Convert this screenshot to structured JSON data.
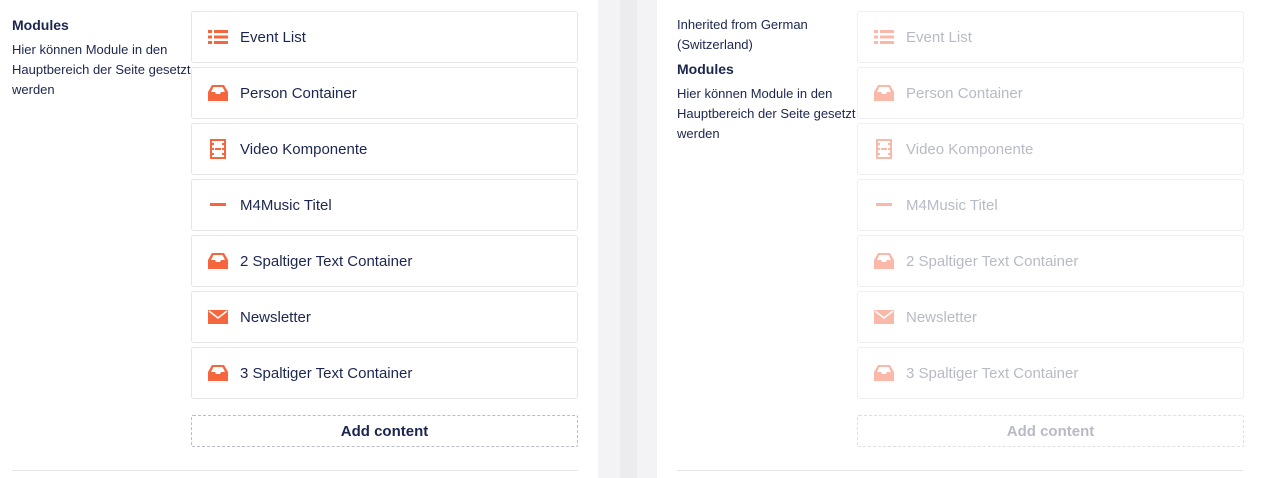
{
  "colors": {
    "accent": "#f5663f",
    "text": "#1b264f",
    "muted": "#b8bac6",
    "border": "#e6e6ea",
    "background": "#f3f3f5"
  },
  "left": {
    "property_title": "Modules",
    "property_description": "Hier können Module in den Hauptbereich der Seite gesetzt werden",
    "blocks": [
      {
        "label": "Event List",
        "icon": "list-icon"
      },
      {
        "label": "Person Container",
        "icon": "inbox-icon"
      },
      {
        "label": "Video Komponente",
        "icon": "film-icon"
      },
      {
        "label": "M4Music Titel",
        "icon": "minus-icon"
      },
      {
        "label": "2 Spaltiger Text Container",
        "icon": "inbox-icon"
      },
      {
        "label": "Newsletter",
        "icon": "envelope-icon"
      },
      {
        "label": "3 Spaltiger Text Container",
        "icon": "inbox-icon"
      }
    ],
    "add_content_label": "Add content"
  },
  "right": {
    "inherited_text": "Inherited from German (Switzerland)",
    "property_title": "Modules",
    "property_description": "Hier können Module in den Hauptbereich der Seite gesetzt werden",
    "blocks": [
      {
        "label": "Event List",
        "icon": "list-icon"
      },
      {
        "label": "Person Container",
        "icon": "inbox-icon"
      },
      {
        "label": "Video Komponente",
        "icon": "film-icon"
      },
      {
        "label": "M4Music Titel",
        "icon": "minus-icon"
      },
      {
        "label": "2 Spaltiger Text Container",
        "icon": "inbox-icon"
      },
      {
        "label": "Newsletter",
        "icon": "envelope-icon"
      },
      {
        "label": "3 Spaltiger Text Container",
        "icon": "inbox-icon"
      }
    ],
    "add_content_label": "Add content"
  }
}
